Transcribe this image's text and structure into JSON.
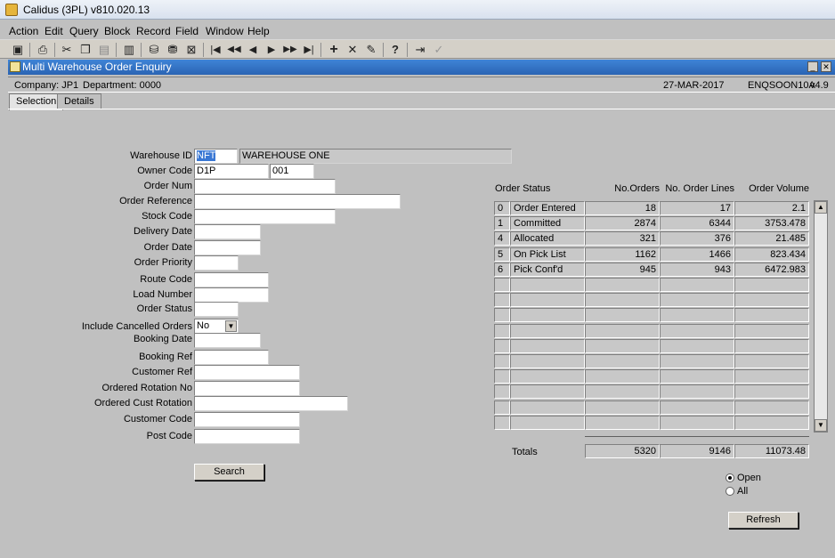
{
  "app": {
    "title": "Calidus (3PL) v810.020.13"
  },
  "menu": [
    "Action",
    "Edit",
    "Query",
    "Block",
    "Record",
    "Field",
    "Window",
    "Help"
  ],
  "toolbar_icons": [
    "save-icon",
    "print-icon",
    "cut-icon",
    "copy-icon",
    "paste-icon",
    "clear-icon",
    "enter-query-icon",
    "execute-query-icon",
    "cancel-query-icon",
    "first-record-icon",
    "previous-block-icon",
    "previous-record-icon",
    "next-record-icon",
    "next-block-icon",
    "last-record-icon",
    "insert-record-icon",
    "delete-record-icon",
    "duplicate-record-icon",
    "help-icon",
    "exit-icon",
    "accept-icon"
  ],
  "window": {
    "title": "Multi Warehouse Order Enquiry",
    "company": "Company: JP1",
    "department": "Department: 0000",
    "date": "27-MAR-2017",
    "form_code": "ENQSOON10A",
    "version": "v4.9"
  },
  "tabs": [
    {
      "label": "Selection"
    },
    {
      "label": "Details"
    }
  ],
  "form": {
    "warehouse_id": {
      "label": "Warehouse ID",
      "value": "NFT",
      "desc": "WAREHOUSE ONE"
    },
    "owner_code": {
      "label": "Owner Code",
      "value": "D1P",
      "extra": "001"
    },
    "order_num": {
      "label": "Order Num",
      "value": ""
    },
    "order_reference": {
      "label": "Order Reference",
      "value": ""
    },
    "stock_code": {
      "label": "Stock Code",
      "value": ""
    },
    "delivery_date": {
      "label": "Delivery Date",
      "value": ""
    },
    "order_date": {
      "label": "Order Date",
      "value": ""
    },
    "order_priority": {
      "label": "Order Priority",
      "value": ""
    },
    "route_code": {
      "label": "Route Code",
      "value": ""
    },
    "load_number": {
      "label": "Load Number",
      "value": ""
    },
    "order_status": {
      "label": "Order Status",
      "value": ""
    },
    "include_cancelled": {
      "label": "Include Cancelled Orders",
      "value": "No"
    },
    "booking_date": {
      "label": "Booking Date",
      "value": ""
    },
    "booking_ref": {
      "label": "Booking Ref",
      "value": ""
    },
    "customer_ref": {
      "label": "Customer Ref",
      "value": ""
    },
    "ordered_rotation_no": {
      "label": "Ordered Rotation No",
      "value": ""
    },
    "ordered_cust_rotation": {
      "label": "Ordered Cust Rotation",
      "value": ""
    },
    "customer_code": {
      "label": "Customer Code",
      "value": ""
    },
    "post_code": {
      "label": "Post Code",
      "value": ""
    },
    "search_label": "Search"
  },
  "grid": {
    "headers": {
      "status": "Order Status",
      "orders": "No.Orders",
      "lines": "No. Order Lines",
      "volume": "Order Volume"
    },
    "rows": [
      {
        "code": "0",
        "status": "Order Entered",
        "orders": "18",
        "lines": "17",
        "volume": "2.1"
      },
      {
        "code": "1",
        "status": "Committed",
        "orders": "2874",
        "lines": "6344",
        "volume": "3753.478"
      },
      {
        "code": "4",
        "status": "Allocated",
        "orders": "321",
        "lines": "376",
        "volume": "21.485"
      },
      {
        "code": "5",
        "status": "On Pick List",
        "orders": "1162",
        "lines": "1466",
        "volume": "823.434"
      },
      {
        "code": "6",
        "status": "Pick Conf'd",
        "orders": "945",
        "lines": "943",
        "volume": "6472.983"
      },
      {
        "code": "",
        "status": "",
        "orders": "",
        "lines": "",
        "volume": ""
      },
      {
        "code": "",
        "status": "",
        "orders": "",
        "lines": "",
        "volume": ""
      },
      {
        "code": "",
        "status": "",
        "orders": "",
        "lines": "",
        "volume": ""
      },
      {
        "code": "",
        "status": "",
        "orders": "",
        "lines": "",
        "volume": ""
      },
      {
        "code": "",
        "status": "",
        "orders": "",
        "lines": "",
        "volume": ""
      },
      {
        "code": "",
        "status": "",
        "orders": "",
        "lines": "",
        "volume": ""
      },
      {
        "code": "",
        "status": "",
        "orders": "",
        "lines": "",
        "volume": ""
      },
      {
        "code": "",
        "status": "",
        "orders": "",
        "lines": "",
        "volume": ""
      },
      {
        "code": "",
        "status": "",
        "orders": "",
        "lines": "",
        "volume": ""
      },
      {
        "code": "",
        "status": "",
        "orders": "",
        "lines": "",
        "volume": ""
      }
    ],
    "totals": {
      "label": "Totals",
      "orders": "5320",
      "lines": "9146",
      "volume": "11073.48"
    }
  },
  "filter": {
    "open_label": "Open",
    "all_label": "All",
    "selected": "Open"
  },
  "refresh_label": "Refresh"
}
